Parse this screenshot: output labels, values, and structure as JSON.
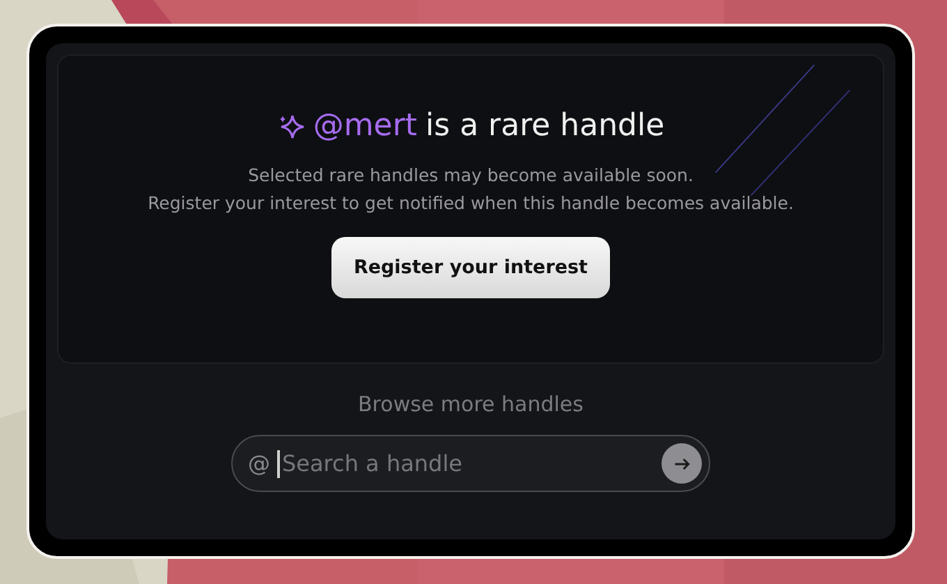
{
  "banner": {
    "handle": "@mert",
    "title": "is a rare handle",
    "description": [
      "Selected rare handles may become available soon.",
      "Register your interest to get notified when this handle becomes available."
    ],
    "button": "Register your interest"
  },
  "browse": {
    "label": "Browse more handles",
    "search": {
      "prefix": "@",
      "placeholder": "Search a handle",
      "focused": true
    }
  }
}
